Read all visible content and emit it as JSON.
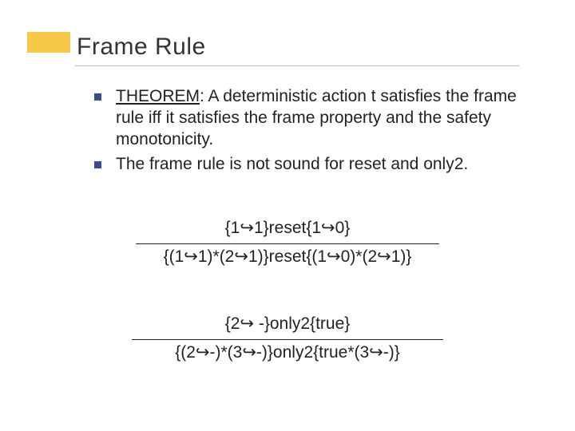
{
  "title": "Frame Rule",
  "bullets": [
    {
      "theorem_label": "THEOREM",
      "rest": ": A deterministic action t satisfies the frame rule iff it satisfies the frame property and the safety monotonicity."
    },
    {
      "text": "The frame rule is not sound for reset and only2."
    }
  ],
  "derivation1": {
    "top": "{1↪1}reset{1↪0}",
    "bottom": "{(1↪1)*(2↪1)}reset{(1↪0)*(2↪1)}"
  },
  "derivation2": {
    "top": "{2↪ -}only2{true}",
    "bottom": "{(2↪-)*(3↪-)}only2{true*(3↪-)}"
  }
}
